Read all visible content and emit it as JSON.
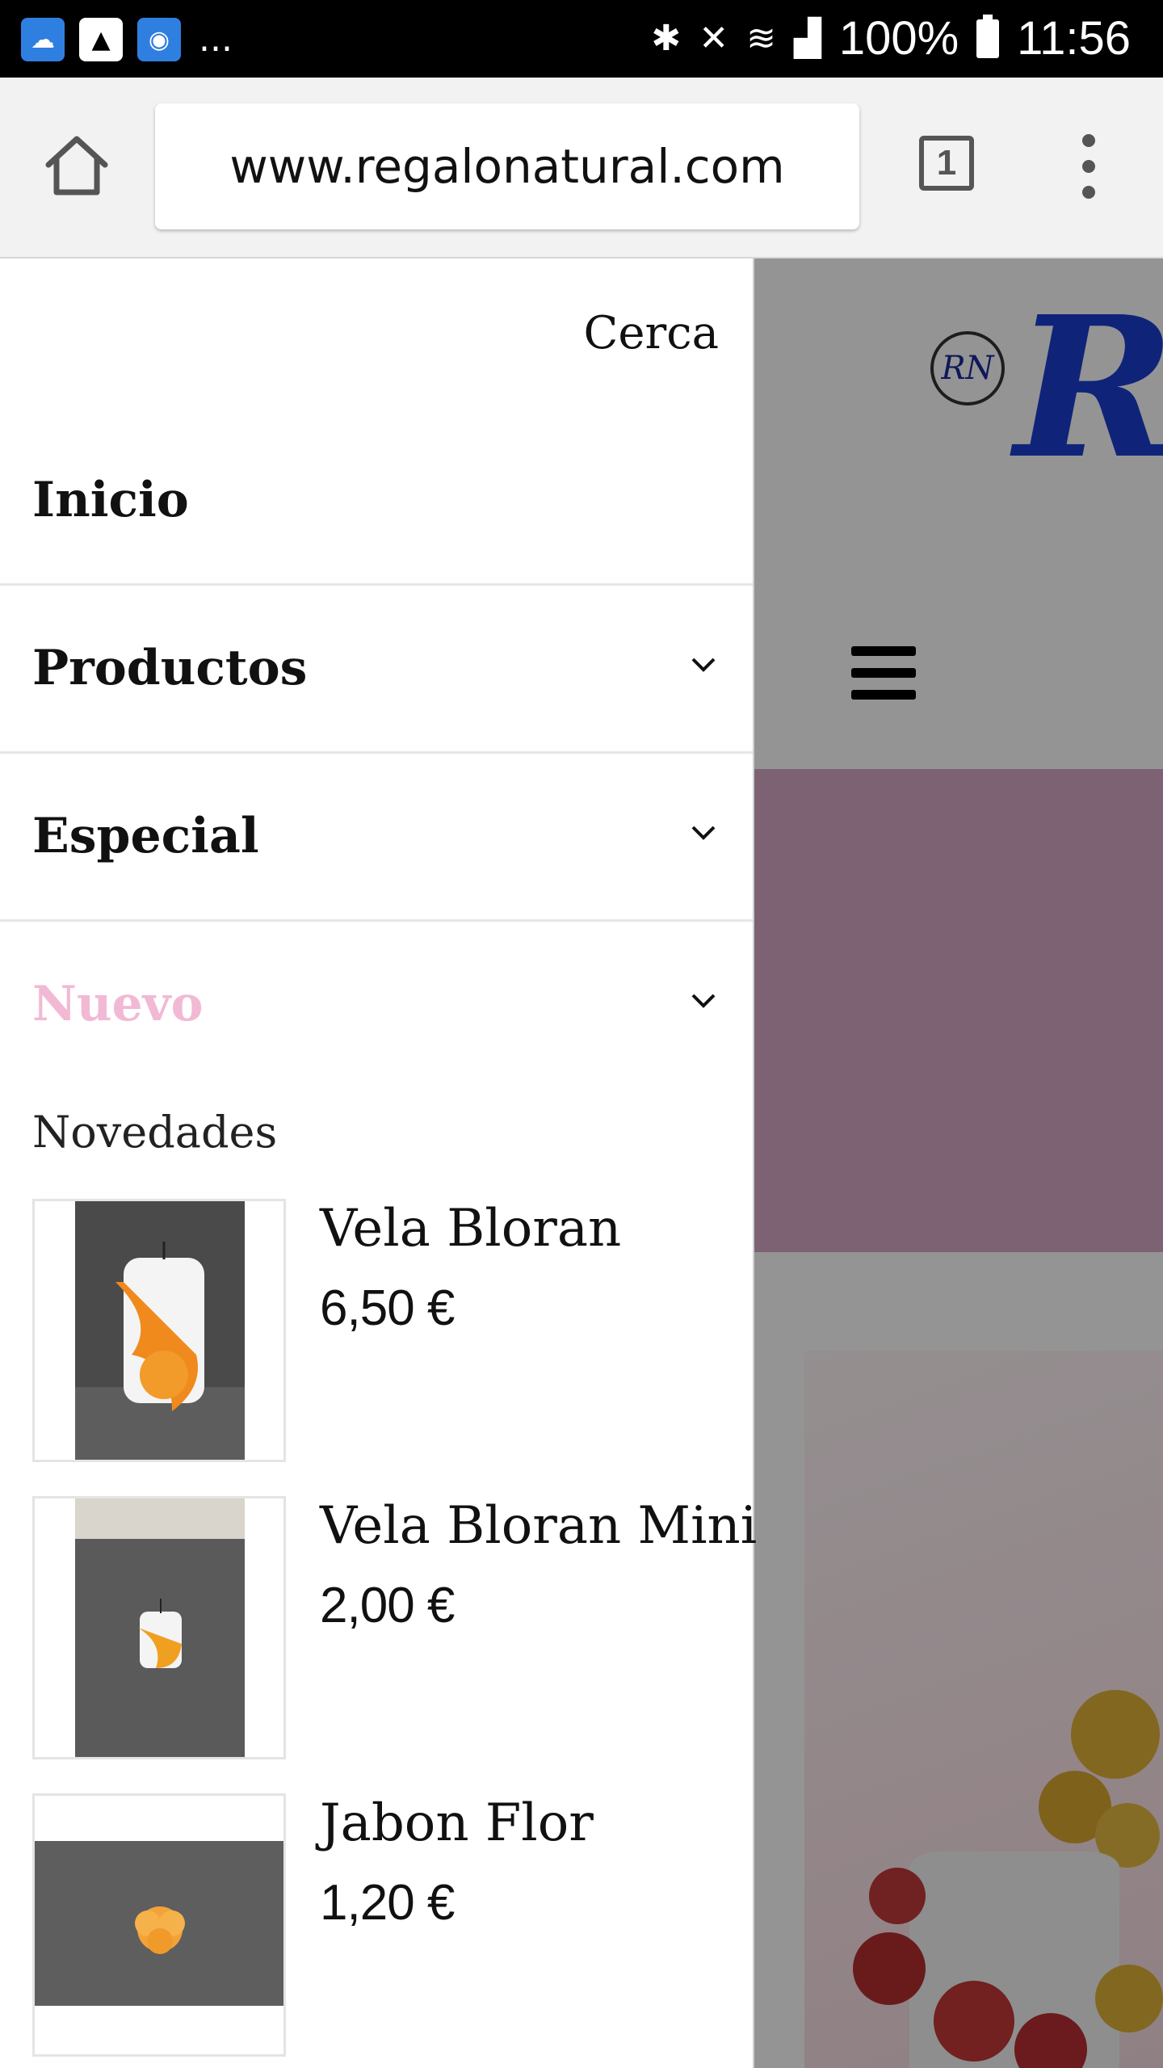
{
  "status_bar": {
    "battery": "100%",
    "time": "11:56",
    "overflow": "..."
  },
  "browser": {
    "url": "www.regalonatural.com",
    "tab_count": "1"
  },
  "drawer": {
    "close_label": "Cerca",
    "nav_items": [
      {
        "label": "Inicio",
        "has_chevron": false,
        "active": false
      },
      {
        "label": "Productos",
        "has_chevron": true,
        "active": false
      },
      {
        "label": "Especial",
        "has_chevron": true,
        "active": false
      },
      {
        "label": "Nuevo",
        "has_chevron": true,
        "active": true
      }
    ],
    "section_title": "Novedades",
    "products": [
      {
        "name": "Vela Bloran",
        "price": "6,50 €"
      },
      {
        "name": "Vela Bloran Mini",
        "price": "2,00 €"
      },
      {
        "name": "Jabon Flor",
        "price": "1,20 €"
      }
    ]
  },
  "colors": {
    "active_nav": "#f2b9d4",
    "banner": "#d7a9c8",
    "logo_blue": "#1a3fd0"
  },
  "icons": [
    "home-icon",
    "tabs-icon",
    "menu-icon",
    "chevron-down-icon",
    "hamburger-icon",
    "bluetooth-icon",
    "wifi-icon",
    "signal-icon",
    "battery-icon"
  ]
}
